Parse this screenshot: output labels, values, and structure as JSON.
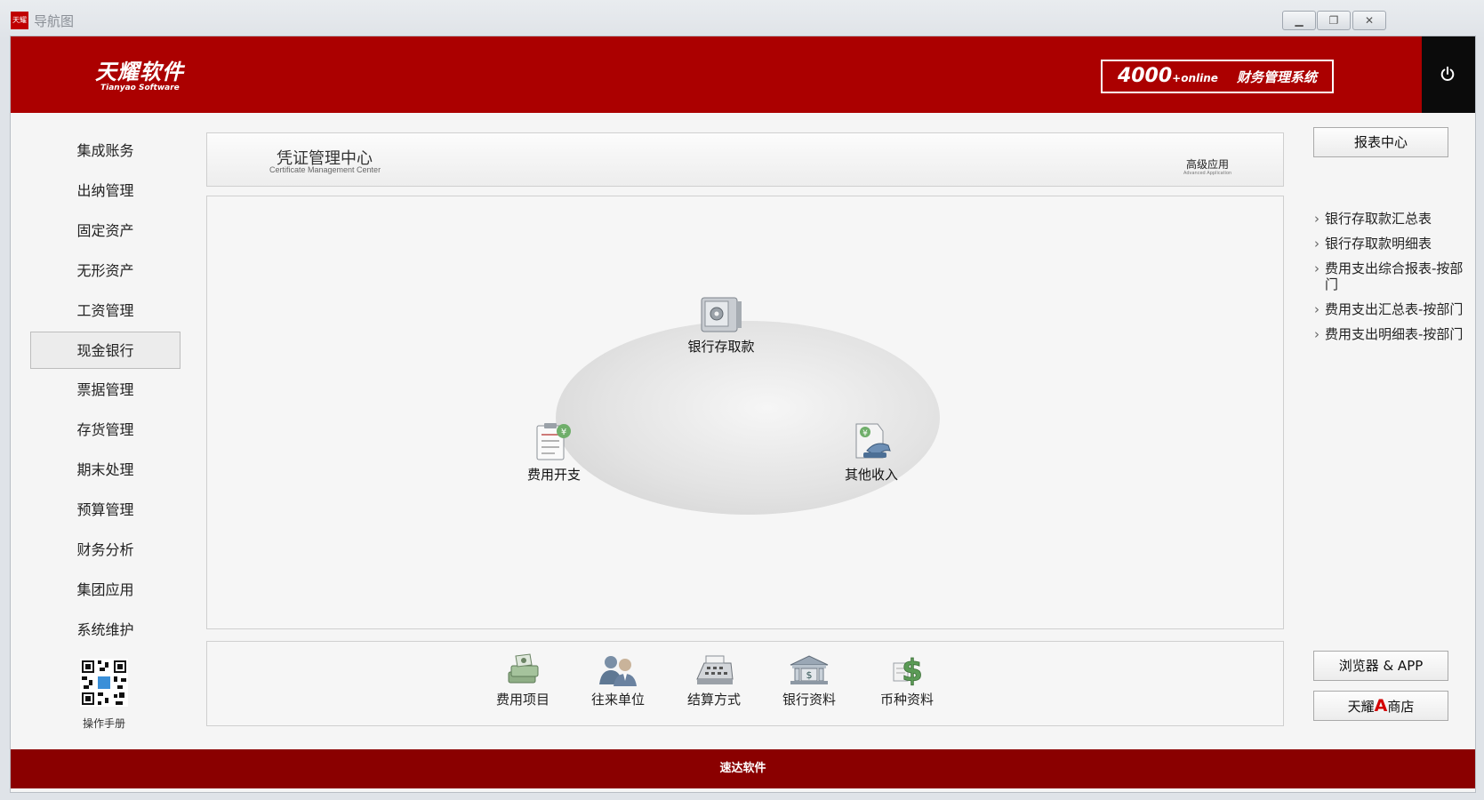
{
  "window": {
    "app_icon_text": "天耀",
    "title": "导航图",
    "buttons": [
      "minimize",
      "maximize",
      "close"
    ]
  },
  "header": {
    "logo_cn": "天耀软件",
    "logo_en": "Tianyao Software",
    "product_number": "4000",
    "product_suffix": "online",
    "product_name": "财务管理系统",
    "power_icon": "power-icon"
  },
  "sidebar": {
    "items": [
      {
        "label": "集成账务"
      },
      {
        "label": "出纳管理"
      },
      {
        "label": "固定资产"
      },
      {
        "label": "无形资产"
      },
      {
        "label": "工资管理"
      },
      {
        "label": "现金银行",
        "active": true
      },
      {
        "label": "票据管理"
      },
      {
        "label": "存货管理"
      },
      {
        "label": "期末处理"
      },
      {
        "label": "预算管理"
      },
      {
        "label": "财务分析"
      },
      {
        "label": "集团应用"
      },
      {
        "label": "系统维护"
      }
    ],
    "manual_label": "操作手册"
  },
  "center": {
    "title": "凭证管理中心",
    "subtitle": "Certificate Management Center",
    "advanced_label": "高级应用",
    "advanced_sub": "Advanced Application",
    "nodes": [
      {
        "label": "银行存取款",
        "icon": "safe-icon"
      },
      {
        "label": "费用开支",
        "icon": "clipboard-yen-icon"
      },
      {
        "label": "其他收入",
        "icon": "income-phone-icon"
      }
    ]
  },
  "toolbar": {
    "items": [
      {
        "label": "费用项目",
        "icon": "money-stack-icon"
      },
      {
        "label": "往来单位",
        "icon": "people-icon"
      },
      {
        "label": "结算方式",
        "icon": "calculator-icon"
      },
      {
        "label": "银行资料",
        "icon": "bank-icon"
      },
      {
        "label": "币种资料",
        "icon": "dollar-icon"
      }
    ]
  },
  "right": {
    "report_center_label": "报表中心",
    "reports": [
      "银行存取款汇总表",
      "银行存取款明细表",
      "费用支出综合报表-按部门",
      "费用支出汇总表-按部门",
      "费用支出明细表-按部门"
    ],
    "browser_app_label": "浏览器 & APP",
    "store_prefix": "天耀",
    "store_mark": "A",
    "store_suffix": "商店"
  },
  "footer": {
    "text": "速达软件"
  },
  "colors": {
    "brand_red": "#ab0000",
    "footer_red": "#8a0000",
    "accent_green": "#6fae6a"
  }
}
